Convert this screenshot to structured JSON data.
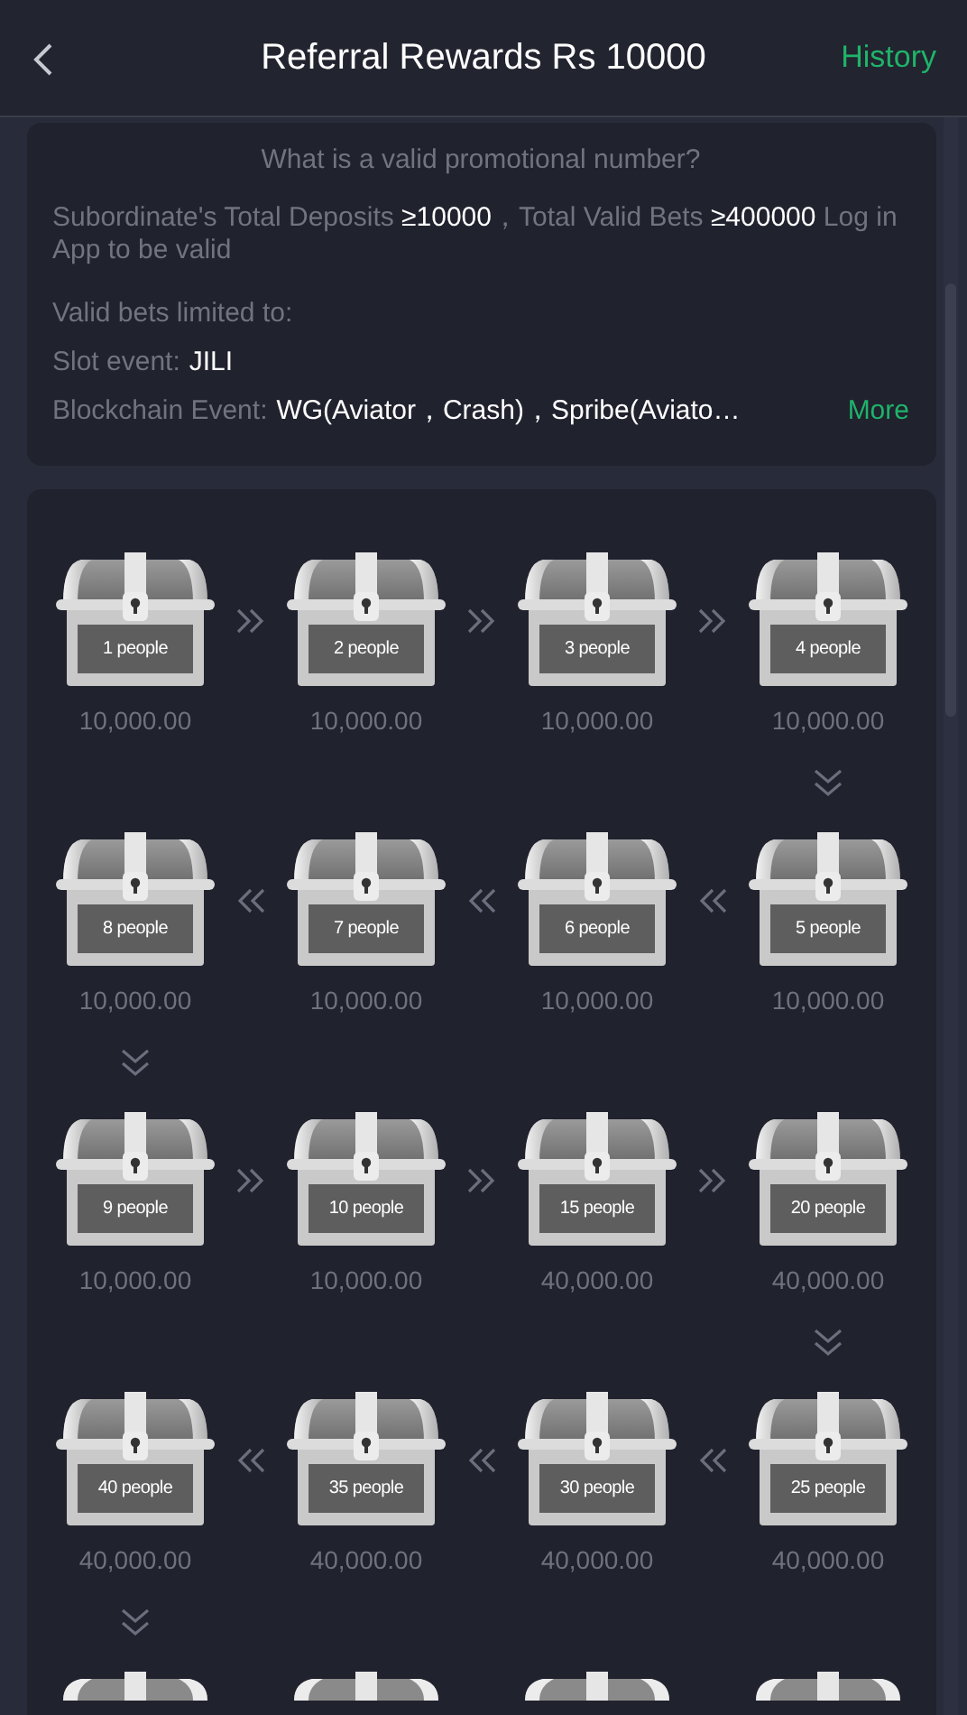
{
  "header": {
    "title": "Referral Rewards Rs 10000",
    "action": "History"
  },
  "rules": {
    "question": "What is a valid promotional number?",
    "requirement": "Subordinate's Total Deposits **≥10000**，Total Valid Bets **≥400000** Log in App to be valid",
    "limited_title": "Valid bets limited to:",
    "lines": [
      {
        "label": "Slot event:",
        "value": "JILI"
      },
      {
        "label": "Blockchain Event:",
        "value": "WG(Aviator，Crash)，Spribe(Aviato…"
      }
    ],
    "more": "More"
  },
  "rewards": [
    {
      "people": "1 people",
      "amount": "10,000.00"
    },
    {
      "people": "2 people",
      "amount": "10,000.00"
    },
    {
      "people": "3 people",
      "amount": "10,000.00"
    },
    {
      "people": "4 people",
      "amount": "10,000.00"
    },
    {
      "people": "8 people",
      "amount": "10,000.00"
    },
    {
      "people": "7 people",
      "amount": "10,000.00"
    },
    {
      "people": "6 people",
      "amount": "10,000.00"
    },
    {
      "people": "5 people",
      "amount": "10,000.00"
    },
    {
      "people": "9 people",
      "amount": "10,000.00"
    },
    {
      "people": "10 people",
      "amount": "10,000.00"
    },
    {
      "people": "15 people",
      "amount": "40,000.00"
    },
    {
      "people": "20 people",
      "amount": "40,000.00"
    },
    {
      "people": "40 people",
      "amount": "40,000.00"
    },
    {
      "people": "35 people",
      "amount": "40,000.00"
    },
    {
      "people": "30 people",
      "amount": "40,000.00"
    },
    {
      "people": "25 people",
      "amount": "40,000.00"
    }
  ]
}
